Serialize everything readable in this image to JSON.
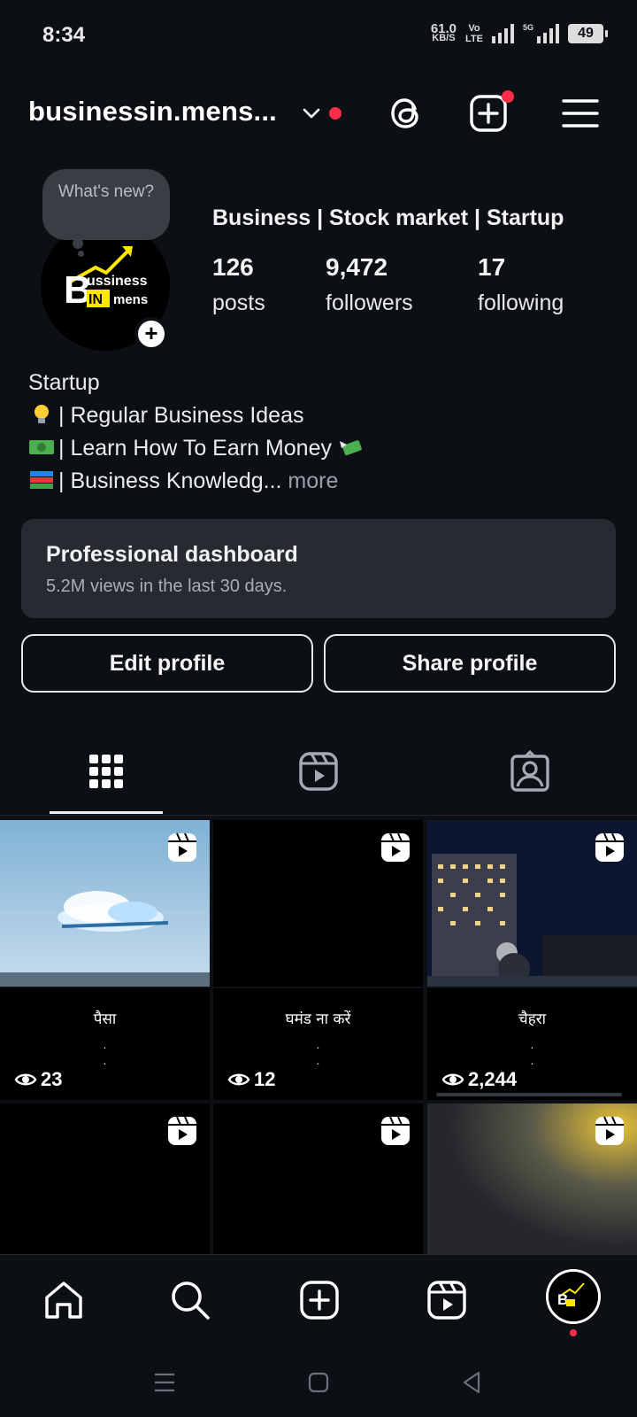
{
  "status_bar": {
    "time": "8:34",
    "net_speed_value": "61.0",
    "net_speed_unit": "KB/S",
    "volte_top": "Vo",
    "volte_bottom": "LTE",
    "network_5g": "5G",
    "battery": "49"
  },
  "header": {
    "username": "businessin.mens...",
    "icons": [
      "chevron-down-icon",
      "threads-icon",
      "create-icon",
      "menu-icon"
    ]
  },
  "profile": {
    "note_bubble": "What's new?",
    "avatar_text_top": "ussiness",
    "avatar_letters": "B",
    "avatar_in": "IN",
    "avatar_text_bottom": "mens",
    "category": "Business | Stock market | Startup",
    "stats": [
      {
        "value": "126",
        "label": "posts"
      },
      {
        "value": "9,472",
        "label": "followers"
      },
      {
        "value": "17",
        "label": "following"
      }
    ],
    "bio_title": "Startup",
    "bio_lines": [
      {
        "icon": "lightbulb-emoji",
        "text": "| Regular Business Ideas"
      },
      {
        "icon": "dollar-banknote-emoji",
        "text": "| Learn How To Earn Money",
        "trailing_icon": "money-with-wings-emoji"
      },
      {
        "icon": "books-emoji",
        "text": "| Business Knowledg..."
      }
    ],
    "bio_more": "more"
  },
  "dashboard": {
    "title": "Professional dashboard",
    "subtitle": "5.2M views in the last 30 days."
  },
  "buttons": {
    "edit_profile": "Edit profile",
    "share_profile": "Share profile"
  },
  "tabs": [
    "grid-icon",
    "reels-icon",
    "tagged-icon"
  ],
  "grid": {
    "row1": [
      {
        "caption": "पैसा",
        "views": "23"
      },
      {
        "caption": "घमंड ना करें",
        "views": "12"
      },
      {
        "caption": "चैहरा",
        "views": "2,244"
      }
    ]
  },
  "bottom_nav": [
    "home-icon",
    "search-icon",
    "create-icon",
    "reels-icon",
    "profile-avatar"
  ]
}
